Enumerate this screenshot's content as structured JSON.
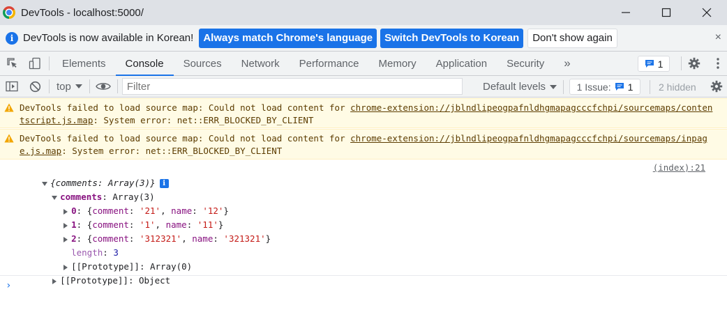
{
  "window": {
    "title": "DevTools - localhost:5000/"
  },
  "infobar": {
    "message": "DevTools is now available in Korean!",
    "btn_match": "Always match Chrome's language",
    "btn_switch": "Switch DevTools to Korean",
    "btn_dismiss": "Don't show again",
    "close": "×"
  },
  "tabs": {
    "items": [
      "Elements",
      "Console",
      "Sources",
      "Network",
      "Performance",
      "Memory",
      "Application",
      "Security"
    ],
    "active": "Console",
    "more": "»",
    "issue_count": "1"
  },
  "console_toolbar": {
    "context": "top",
    "filter_placeholder": "Filter",
    "levels": "Default levels",
    "issues_label": "1 Issue:",
    "issues_count": "1",
    "hidden": "2 hidden"
  },
  "messages": {
    "warn1": {
      "prefix": "DevTools failed to load source map: Could not load content for ",
      "link": "chrome-extension://jblndlipeogpafnldhgmapagcccfchpi/sourcemaps/contentscript.js.map",
      "suffix": ": System error: net::ERR_BLOCKED_BY_CLIENT"
    },
    "warn2": {
      "prefix": "DevTools failed to load source map: Could not load content for ",
      "link": "chrome-extension://jblndlipeogpafnldhgmapagcccfchpi/sourcemaps/inpage.js.map",
      "suffix": ": System error: net::ERR_BLOCKED_BY_CLIENT"
    },
    "log": {
      "summary": "{comments: Array(3)}",
      "source": "(index):21",
      "comments_key": "comments",
      "comments_type": "Array(3)",
      "items": [
        {
          "index": "0",
          "comment": "'21'",
          "name": "'12'"
        },
        {
          "index": "1",
          "comment": "'1'",
          "name": "'11'"
        },
        {
          "index": "2",
          "comment": "'312321'",
          "name": "'321321'"
        }
      ],
      "length_key": "length",
      "length_value": "3",
      "array_proto": "[[Prototype]]: Array(0)",
      "object_proto": "[[Prototype]]: Object"
    }
  },
  "prompt": "›"
}
